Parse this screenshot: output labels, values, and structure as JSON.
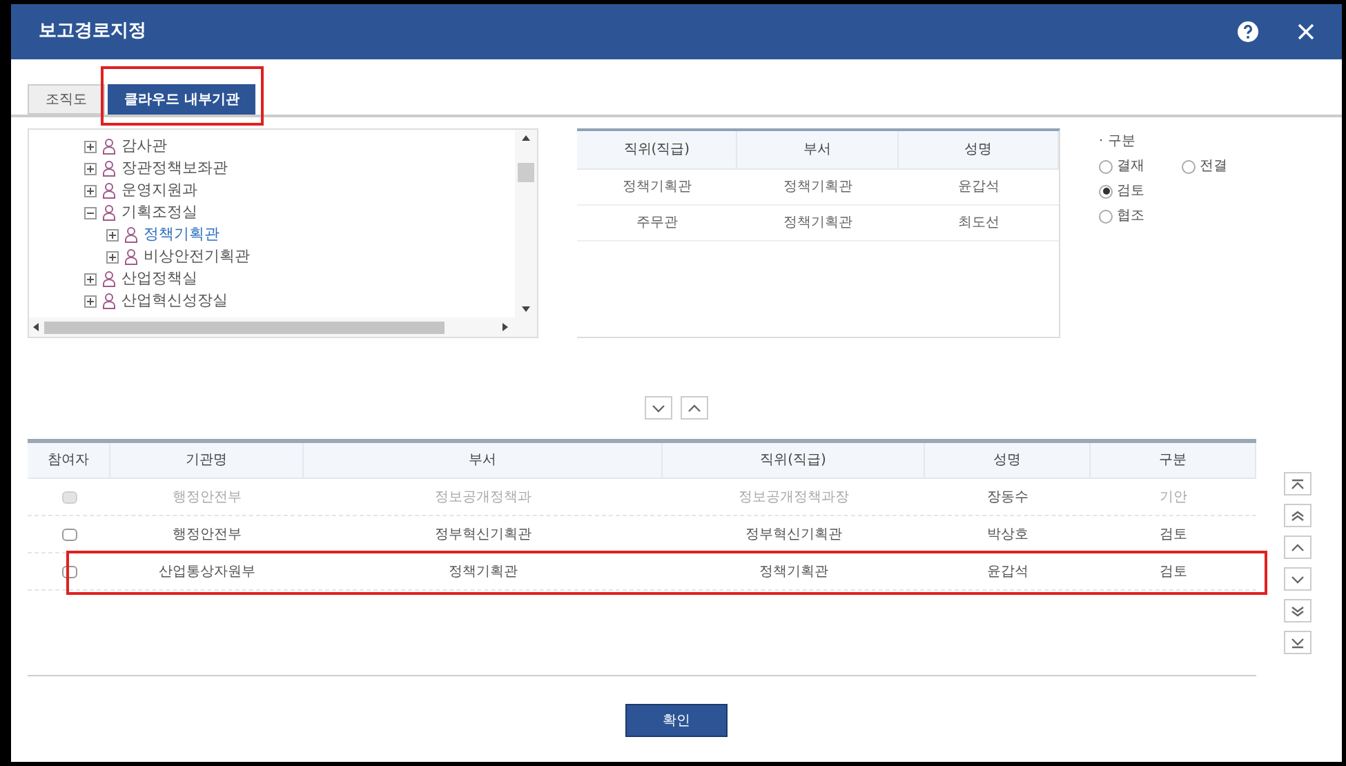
{
  "window": {
    "title": "보고경로지정"
  },
  "tabs": [
    {
      "label": "조직도",
      "selected": false,
      "highlighted": false
    },
    {
      "label": "클라우드 내부기관",
      "selected": true,
      "highlighted": true
    }
  ],
  "tree": [
    {
      "label": "감사관",
      "expanded": false,
      "selected": false
    },
    {
      "label": "장관정책보좌관",
      "expanded": false,
      "selected": false
    },
    {
      "label": "운영지원과",
      "expanded": false,
      "selected": false
    },
    {
      "label": "기획조정실",
      "expanded": true,
      "selected": false,
      "children": [
        {
          "label": "정책기획관",
          "expanded": false,
          "selected": true
        },
        {
          "label": "비상안전기획관",
          "expanded": false,
          "selected": false
        }
      ]
    },
    {
      "label": "산업정책실",
      "expanded": false,
      "selected": false
    },
    {
      "label": "산업혁신성장실",
      "expanded": false,
      "selected": false
    }
  ],
  "person_table": {
    "columns": [
      "직위(직급)",
      "부서",
      "성명"
    ],
    "rows": [
      [
        "정책기획관",
        "정책기획관",
        "윤갑석"
      ],
      [
        "주무관",
        "정책기획관",
        "최도선"
      ]
    ]
  },
  "type_group": {
    "title": "· 구분",
    "options": [
      {
        "label": "결재",
        "selected": false
      },
      {
        "label": "전결",
        "selected": false
      },
      {
        "label": "검토",
        "selected": true
      },
      {
        "label": "협조",
        "selected": false
      }
    ]
  },
  "route_table": {
    "columns": [
      "참여자",
      "기관명",
      "부서",
      "직위(직급)",
      "성명",
      "구분"
    ],
    "rows": [
      {
        "cells": [
          "",
          "행정안전부",
          "정보공개정책과",
          "정보공개정책과장",
          "장동수",
          "기안"
        ],
        "disabled": true,
        "highlighted": false
      },
      {
        "cells": [
          "",
          "행정안전부",
          "정부혁신기획관",
          "정부혁신기획관",
          "박상호",
          "검토"
        ],
        "disabled": false,
        "highlighted": false
      },
      {
        "cells": [
          "",
          "산업통상자원부",
          "정책기획관",
          "정책기획관",
          "윤갑석",
          "검토"
        ],
        "disabled": false,
        "highlighted": true
      }
    ]
  },
  "confirm_button": "확인"
}
